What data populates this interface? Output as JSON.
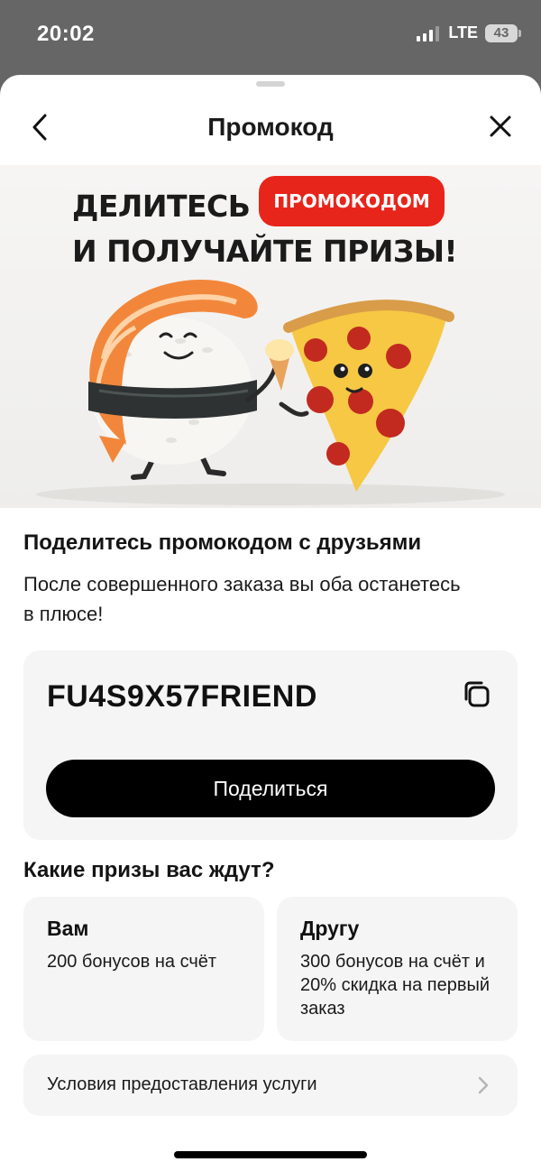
{
  "status_bar": {
    "time": "20:02",
    "network": "LTE",
    "battery": "43"
  },
  "header": {
    "title": "Промокод",
    "back_icon": "chevron-left-icon",
    "close_icon": "close-icon"
  },
  "banner": {
    "headline_line1": "ДЕЛИТЕСЬ",
    "headline_pill": "ПРОМОКОДОМ",
    "headline_line2": "И ПОЛУЧАЙТЕ ПРИЗЫ!",
    "accent_color": "#e8251a",
    "illustration": "sushi-and-pizza-characters"
  },
  "share": {
    "title": "Поделитесь промокодом с друзьями",
    "description": "После совершенного заказа вы оба останетесь в плюсе!",
    "promo_code": "FU4S9X57FRIEND",
    "copy_icon": "copy-icon",
    "share_button": "Поделиться"
  },
  "prizes": {
    "title": "Какие призы вас ждут?",
    "cards": [
      {
        "title": "Вам",
        "text": "200 бонусов на счёт"
      },
      {
        "title": "Другу",
        "text": "300 бонусов на счёт и 20% скидка на первый заказ"
      }
    ]
  },
  "terms": {
    "label": "Условия предоставления услуги",
    "icon": "chevron-right-icon"
  }
}
